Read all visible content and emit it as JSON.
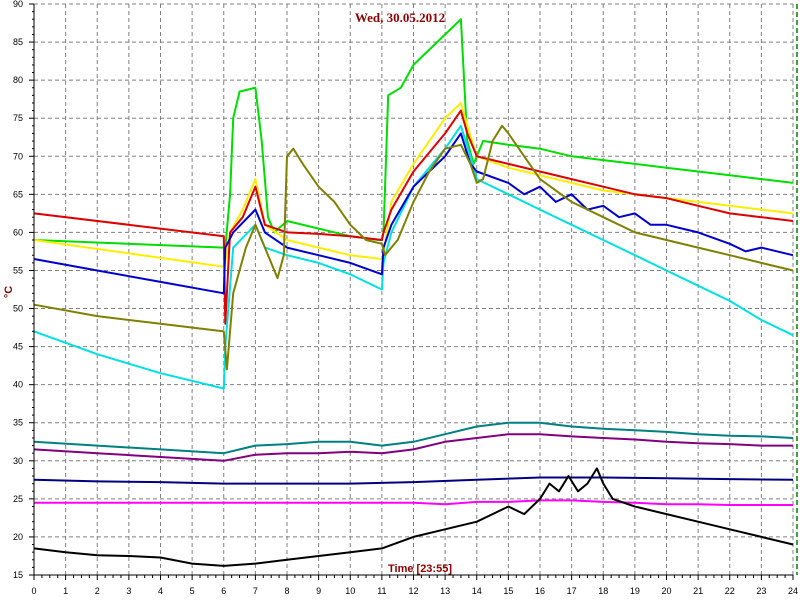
{
  "chart_data": {
    "type": "line",
    "title": "Wed, 30.05.2012",
    "xlabel": "Time [23:55]",
    "ylabel": "°C",
    "xlim": [
      0,
      24
    ],
    "ylim": [
      15,
      90
    ],
    "x_ticks": [
      "0",
      "1",
      "2",
      "3",
      "4",
      "5",
      "6",
      "7",
      "8",
      "9",
      "10",
      "11",
      "12",
      "13",
      "14",
      "15",
      "16",
      "17",
      "18",
      "19",
      "20",
      "21",
      "22",
      "23",
      "24"
    ],
    "y_ticks": [
      "15",
      "20",
      "25",
      "30",
      "35",
      "40",
      "45",
      "50",
      "55",
      "60",
      "65",
      "70",
      "75",
      "80",
      "85",
      "90"
    ],
    "grid": true,
    "colors": {
      "grid": "#808080",
      "title": "#8b0000",
      "right_axis": "#008000"
    },
    "series": [
      {
        "color": "#00dd00",
        "points": [
          [
            0,
            59
          ],
          [
            6,
            58
          ],
          [
            6.05,
            58
          ],
          [
            6.2,
            65
          ],
          [
            6.3,
            75
          ],
          [
            6.5,
            78.5
          ],
          [
            7,
            79
          ],
          [
            7.2,
            72
          ],
          [
            7.4,
            62
          ],
          [
            7.6,
            60
          ],
          [
            8,
            61.5
          ],
          [
            10,
            59.5
          ],
          [
            10.9,
            59
          ],
          [
            11,
            59
          ],
          [
            11.05,
            60
          ],
          [
            11.2,
            78
          ],
          [
            11.6,
            79
          ],
          [
            12,
            82
          ],
          [
            13,
            86
          ],
          [
            13.5,
            88
          ],
          [
            13.6,
            80
          ],
          [
            13.7,
            72
          ],
          [
            13.9,
            69
          ],
          [
            14,
            70
          ],
          [
            14.2,
            72
          ],
          [
            15,
            71.5
          ],
          [
            16,
            71
          ],
          [
            17,
            70
          ],
          [
            18,
            69.5
          ],
          [
            19,
            69
          ],
          [
            20,
            68.5
          ],
          [
            21,
            68
          ],
          [
            22,
            67.5
          ],
          [
            23,
            67
          ],
          [
            24,
            66.5
          ]
        ]
      },
      {
        "color": "#ffee00",
        "points": [
          [
            0,
            59
          ],
          [
            6,
            55.5
          ],
          [
            6.05,
            56
          ],
          [
            6.2,
            60
          ],
          [
            6.6,
            63
          ],
          [
            7,
            67
          ],
          [
            7.3,
            61
          ],
          [
            8,
            59
          ],
          [
            9,
            58
          ],
          [
            10,
            57
          ],
          [
            11,
            56.5
          ],
          [
            11.05,
            57
          ],
          [
            11.3,
            64
          ],
          [
            12,
            69
          ],
          [
            13,
            75
          ],
          [
            13.5,
            77
          ],
          [
            13.7,
            74
          ],
          [
            14,
            70
          ],
          [
            15,
            68.5
          ],
          [
            16,
            67.5
          ],
          [
            17,
            66.5
          ],
          [
            18,
            65.5
          ],
          [
            19,
            65
          ],
          [
            20,
            64.5
          ],
          [
            21,
            64
          ],
          [
            22,
            63.5
          ],
          [
            23,
            63
          ],
          [
            24,
            62.5
          ]
        ]
      },
      {
        "color": "#dd0000",
        "points": [
          [
            0,
            62.5
          ],
          [
            6,
            59.5
          ],
          [
            6.05,
            48
          ],
          [
            6.2,
            60
          ],
          [
            6.6,
            62
          ],
          [
            7,
            66
          ],
          [
            7.3,
            61
          ],
          [
            8,
            60
          ],
          [
            9,
            59.8
          ],
          [
            10,
            59.5
          ],
          [
            11,
            59
          ],
          [
            11.05,
            60
          ],
          [
            11.3,
            63
          ],
          [
            12,
            68
          ],
          [
            13,
            73
          ],
          [
            13.5,
            76
          ],
          [
            13.7,
            73
          ],
          [
            14,
            70
          ],
          [
            15,
            69
          ],
          [
            16,
            68
          ],
          [
            17,
            67
          ],
          [
            18,
            66
          ],
          [
            19,
            65
          ],
          [
            20,
            64.5
          ],
          [
            21,
            63.5
          ],
          [
            22,
            62.5
          ],
          [
            23,
            62
          ],
          [
            24,
            61.5
          ]
        ]
      },
      {
        "color": "#00e0e0",
        "points": [
          [
            0,
            47
          ],
          [
            2,
            44
          ],
          [
            4,
            41.5
          ],
          [
            6,
            39.5
          ],
          [
            6.05,
            45
          ],
          [
            6.3,
            58
          ],
          [
            7,
            61
          ],
          [
            7.3,
            58
          ],
          [
            8,
            57
          ],
          [
            9,
            56
          ],
          [
            10,
            54.5
          ],
          [
            11,
            52.5
          ],
          [
            11.05,
            56
          ],
          [
            11.3,
            60
          ],
          [
            12,
            66
          ],
          [
            13,
            71
          ],
          [
            13.5,
            74
          ],
          [
            13.8,
            70
          ],
          [
            14,
            67
          ],
          [
            15,
            65
          ],
          [
            16,
            63
          ],
          [
            17,
            61
          ],
          [
            18,
            59
          ],
          [
            19,
            57
          ],
          [
            20,
            55
          ],
          [
            21,
            53
          ],
          [
            22,
            51
          ],
          [
            23,
            48.5
          ],
          [
            24,
            46.5
          ]
        ]
      },
      {
        "color": "#0000cc",
        "points": [
          [
            0,
            56.5
          ],
          [
            2,
            55
          ],
          [
            4,
            53.5
          ],
          [
            6,
            52
          ],
          [
            6.05,
            58
          ],
          [
            6.3,
            60
          ],
          [
            7,
            63
          ],
          [
            7.3,
            60
          ],
          [
            8,
            58
          ],
          [
            9,
            57
          ],
          [
            10,
            56
          ],
          [
            11,
            54.5
          ],
          [
            11.05,
            58
          ],
          [
            11.3,
            61
          ],
          [
            12,
            66
          ],
          [
            13,
            70
          ],
          [
            13.5,
            73
          ],
          [
            13.8,
            69
          ],
          [
            14,
            68
          ],
          [
            15,
            66.5
          ],
          [
            15.5,
            65
          ],
          [
            16,
            66
          ],
          [
            16.5,
            64
          ],
          [
            17,
            65
          ],
          [
            17.5,
            63
          ],
          [
            18,
            63.5
          ],
          [
            18.5,
            62
          ],
          [
            19,
            62.5
          ],
          [
            19.5,
            61
          ],
          [
            20,
            61
          ],
          [
            20.5,
            60.5
          ],
          [
            21,
            60
          ],
          [
            22,
            58.5
          ],
          [
            22.5,
            57.5
          ],
          [
            23,
            58
          ],
          [
            24,
            57
          ]
        ]
      },
      {
        "color": "#808000",
        "points": [
          [
            0,
            50.5
          ],
          [
            2,
            49
          ],
          [
            4,
            48
          ],
          [
            6,
            47
          ],
          [
            6.1,
            42
          ],
          [
            6.3,
            52
          ],
          [
            6.7,
            58
          ],
          [
            7,
            61
          ],
          [
            7.3,
            58
          ],
          [
            7.7,
            54
          ],
          [
            7.9,
            57
          ],
          [
            8,
            70
          ],
          [
            8.2,
            71
          ],
          [
            8.5,
            69
          ],
          [
            9,
            66
          ],
          [
            9.5,
            64
          ],
          [
            10,
            61
          ],
          [
            10.5,
            59
          ],
          [
            11,
            58.5
          ],
          [
            11.1,
            57
          ],
          [
            11.5,
            59
          ],
          [
            12,
            64
          ],
          [
            12.5,
            68
          ],
          [
            13,
            71
          ],
          [
            13.5,
            71.5
          ],
          [
            13.8,
            69
          ],
          [
            14,
            66.5
          ],
          [
            14.2,
            67
          ],
          [
            14.5,
            72
          ],
          [
            14.8,
            74
          ],
          [
            15,
            73
          ],
          [
            15.5,
            70
          ],
          [
            16,
            67
          ],
          [
            17,
            64
          ],
          [
            18,
            62
          ],
          [
            19,
            60
          ],
          [
            20,
            59
          ],
          [
            21,
            58
          ],
          [
            22,
            57
          ],
          [
            23,
            56
          ],
          [
            24,
            55
          ]
        ]
      },
      {
        "color": "#008080",
        "points": [
          [
            0,
            32.5
          ],
          [
            2,
            32
          ],
          [
            4,
            31.5
          ],
          [
            6,
            31
          ],
          [
            6.5,
            31.5
          ],
          [
            7,
            32
          ],
          [
            8,
            32.2
          ],
          [
            9,
            32.5
          ],
          [
            10,
            32.5
          ],
          [
            11,
            32
          ],
          [
            12,
            32.5
          ],
          [
            13,
            33.5
          ],
          [
            14,
            34.5
          ],
          [
            15,
            35
          ],
          [
            16,
            35
          ],
          [
            17,
            34.5
          ],
          [
            18,
            34.2
          ],
          [
            19,
            34
          ],
          [
            20,
            33.8
          ],
          [
            21,
            33.5
          ],
          [
            22,
            33.3
          ],
          [
            23,
            33.2
          ],
          [
            24,
            33
          ]
        ]
      },
      {
        "color": "#800080",
        "points": [
          [
            0,
            31.5
          ],
          [
            2,
            31
          ],
          [
            4,
            30.5
          ],
          [
            6,
            30
          ],
          [
            7,
            30.8
          ],
          [
            8,
            31
          ],
          [
            9,
            31
          ],
          [
            10,
            31.2
          ],
          [
            11,
            31
          ],
          [
            12,
            31.5
          ],
          [
            13,
            32.5
          ],
          [
            14,
            33
          ],
          [
            15,
            33.5
          ],
          [
            16,
            33.5
          ],
          [
            17,
            33.2
          ],
          [
            18,
            33
          ],
          [
            19,
            32.8
          ],
          [
            20,
            32.5
          ],
          [
            21,
            32.3
          ],
          [
            22,
            32.2
          ],
          [
            23,
            32
          ],
          [
            24,
            32
          ]
        ]
      },
      {
        "color": "#000080",
        "points": [
          [
            0,
            27.5
          ],
          [
            2,
            27.3
          ],
          [
            4,
            27.2
          ],
          [
            6,
            27
          ],
          [
            8,
            27
          ],
          [
            10,
            27
          ],
          [
            12,
            27.2
          ],
          [
            14,
            27.5
          ],
          [
            16,
            27.8
          ],
          [
            18,
            27.8
          ],
          [
            20,
            27.7
          ],
          [
            22,
            27.6
          ],
          [
            24,
            27.5
          ]
        ]
      },
      {
        "color": "#ff00ff",
        "points": [
          [
            0,
            24.5
          ],
          [
            2,
            24.5
          ],
          [
            4,
            24.5
          ],
          [
            6,
            24.5
          ],
          [
            8,
            24.5
          ],
          [
            10,
            24.5
          ],
          [
            12,
            24.5
          ],
          [
            13,
            24.3
          ],
          [
            14,
            24.6
          ],
          [
            15,
            24.6
          ],
          [
            16,
            24.8
          ],
          [
            17,
            24.8
          ],
          [
            18,
            24.6
          ],
          [
            19,
            24.5
          ],
          [
            20,
            24.3
          ],
          [
            21,
            24.3
          ],
          [
            22,
            24.2
          ],
          [
            23,
            24.2
          ],
          [
            24,
            24.2
          ]
        ]
      },
      {
        "color": "#000000",
        "points": [
          [
            0,
            18.5
          ],
          [
            1,
            18
          ],
          [
            2,
            17.6
          ],
          [
            3,
            17.5
          ],
          [
            4,
            17.3
          ],
          [
            5,
            16.5
          ],
          [
            6,
            16.2
          ],
          [
            7,
            16.5
          ],
          [
            8,
            17
          ],
          [
            9,
            17.5
          ],
          [
            10,
            18
          ],
          [
            11,
            18.5
          ],
          [
            12,
            20
          ],
          [
            13,
            21
          ],
          [
            14,
            22
          ],
          [
            14.5,
            23
          ],
          [
            15,
            24
          ],
          [
            15.5,
            23
          ],
          [
            16,
            25
          ],
          [
            16.3,
            27
          ],
          [
            16.6,
            26
          ],
          [
            16.9,
            28
          ],
          [
            17.2,
            26
          ],
          [
            17.5,
            27
          ],
          [
            17.8,
            29
          ],
          [
            18,
            27
          ],
          [
            18.3,
            25
          ],
          [
            19,
            24
          ],
          [
            20,
            23
          ],
          [
            21,
            22
          ],
          [
            22,
            21
          ],
          [
            23,
            20
          ],
          [
            24,
            19
          ]
        ]
      }
    ]
  }
}
